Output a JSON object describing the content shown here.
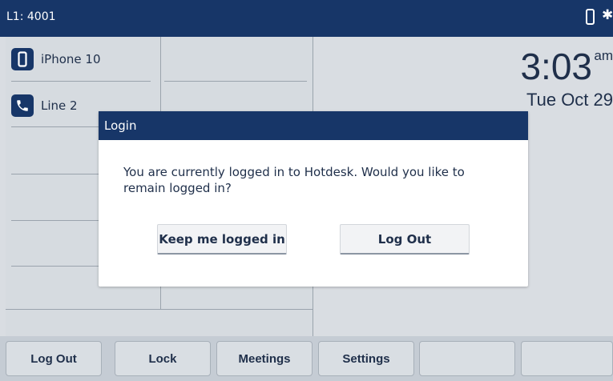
{
  "status_bar": {
    "line_label": "L1: 4001",
    "icons": [
      "mobile-phone-icon",
      "bluetooth-icon"
    ]
  },
  "line_keys": [
    {
      "label": "iPhone 10",
      "icon": "mobile-phone-icon"
    },
    {
      "label": "Line 2",
      "icon": "phone-handset-icon"
    }
  ],
  "clock": {
    "time": "3:03",
    "ampm": "am",
    "date": "Tue Oct 29"
  },
  "dialog": {
    "title": "Login",
    "message": "You are currently logged in to Hotdesk. Would you like to remain logged in?",
    "buttons": {
      "keep": "Keep me logged in",
      "logout": "Log Out"
    }
  },
  "softkeys": [
    "Log Out",
    "Lock",
    "Meetings",
    "Settings",
    "",
    ""
  ],
  "colors": {
    "header": "#173668",
    "background": "#d9dde2",
    "text": "#1f2f4a"
  }
}
